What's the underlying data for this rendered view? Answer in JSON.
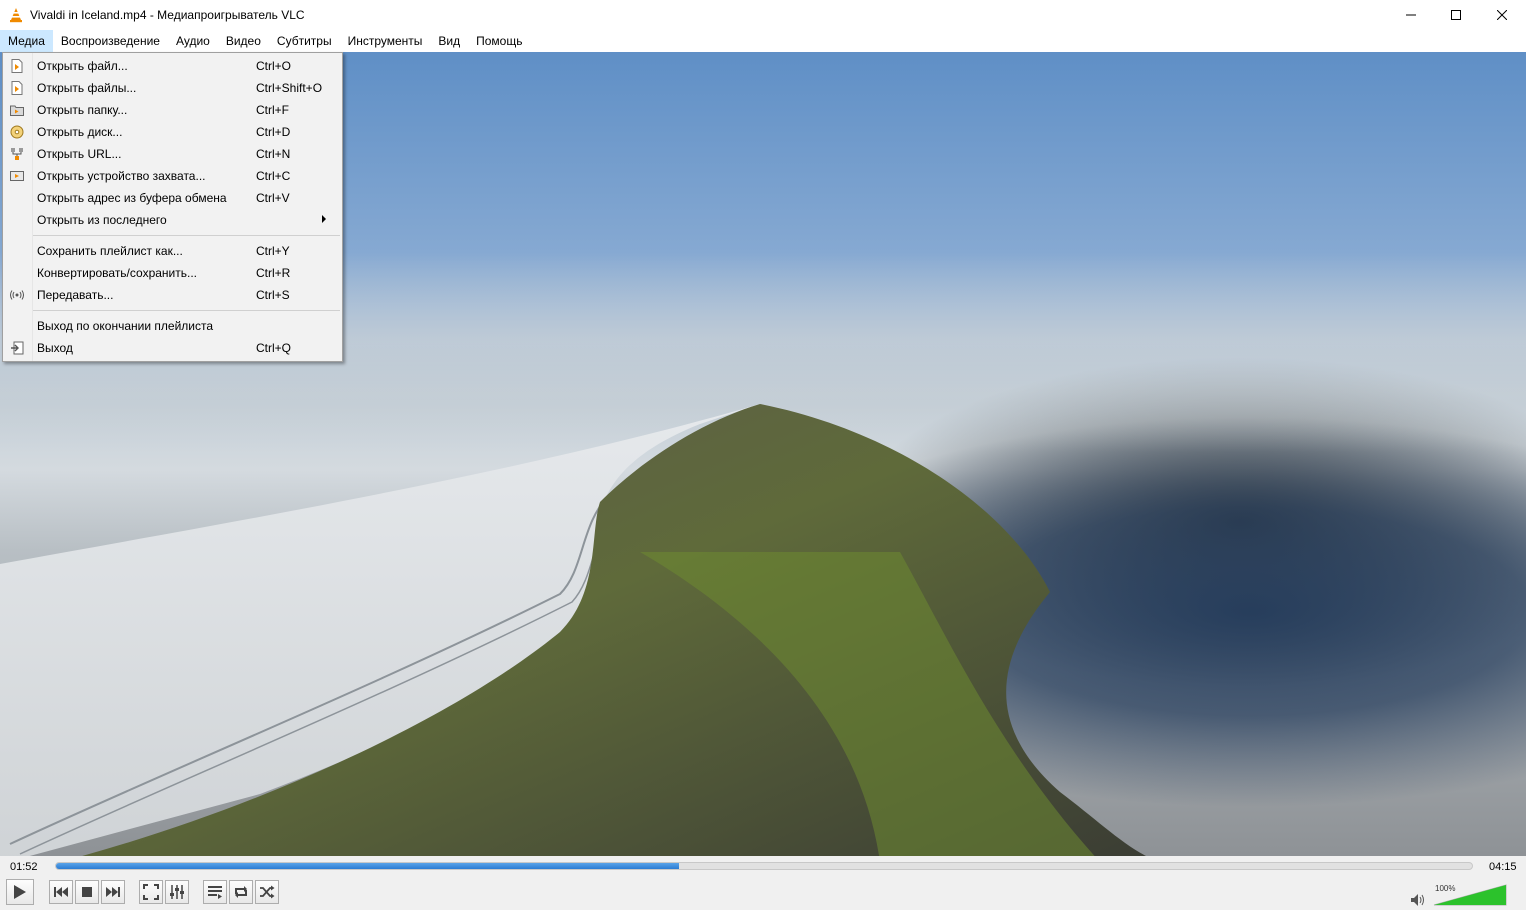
{
  "window": {
    "title": "Vivaldi in Iceland.mp4 - Медиапроигрыватель VLC",
    "icon": "vlc-cone-icon"
  },
  "menubar": {
    "items": [
      {
        "label": "Медиа",
        "active": true
      },
      {
        "label": "Воспроизведение"
      },
      {
        "label": "Аудио"
      },
      {
        "label": "Видео"
      },
      {
        "label": "Субтитры"
      },
      {
        "label": "Инструменты"
      },
      {
        "label": "Вид"
      },
      {
        "label": "Помощь"
      }
    ]
  },
  "media_menu": {
    "items": [
      {
        "label": "Открыть файл...",
        "shortcut": "Ctrl+O",
        "icon": "open-file-icon"
      },
      {
        "label": "Открыть файлы...",
        "shortcut": "Ctrl+Shift+O",
        "icon": "open-files-icon"
      },
      {
        "label": "Открыть папку...",
        "shortcut": "Ctrl+F",
        "icon": "open-folder-icon"
      },
      {
        "label": "Открыть диск...",
        "shortcut": "Ctrl+D",
        "icon": "disc-icon"
      },
      {
        "label": "Открыть URL...",
        "shortcut": "Ctrl+N",
        "icon": "network-icon"
      },
      {
        "label": "Открыть устройство захвата...",
        "shortcut": "Ctrl+C",
        "icon": "capture-device-icon"
      },
      {
        "label": "Открыть адрес из буфера обмена",
        "shortcut": "Ctrl+V"
      },
      {
        "label": "Открыть из последнего",
        "submenu": true
      },
      {
        "label": "Сохранить плейлист как...",
        "shortcut": "Ctrl+Y"
      },
      {
        "label": "Конвертировать/сохранить...",
        "shortcut": "Ctrl+R"
      },
      {
        "label": "Передавать...",
        "shortcut": "Ctrl+S",
        "icon": "stream-icon"
      },
      {
        "label": "Выход по окончании плейлиста"
      },
      {
        "label": "Выход",
        "shortcut": "Ctrl+Q",
        "icon": "exit-icon"
      }
    ]
  },
  "player": {
    "elapsed": "01:52",
    "total": "04:15",
    "progress_percent": 44,
    "volume_label": "100%",
    "volume_percent": 100
  },
  "colors": {
    "accent": "#2b7cd3",
    "menu_highlight": "#cce8ff",
    "volume_green": "#2cc22c"
  }
}
